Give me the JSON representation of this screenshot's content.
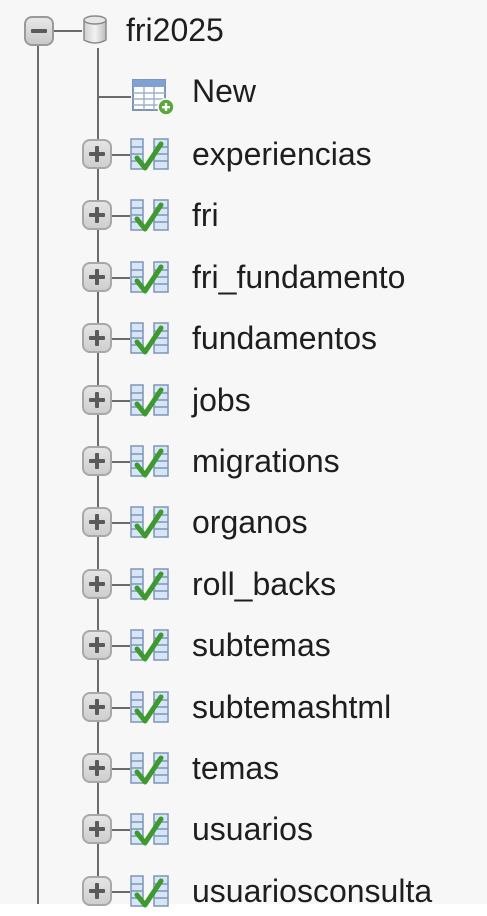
{
  "database": {
    "name": "fri2025",
    "icon": "database-icon",
    "expanded": true
  },
  "new_item": {
    "label": "New",
    "icon": "new-table-icon"
  },
  "tables": [
    {
      "label": "experiencias",
      "icon": "table-icon"
    },
    {
      "label": "fri",
      "icon": "table-icon"
    },
    {
      "label": "fri_fundamento",
      "icon": "table-icon"
    },
    {
      "label": "fundamentos",
      "icon": "table-icon"
    },
    {
      "label": "jobs",
      "icon": "table-icon"
    },
    {
      "label": "migrations",
      "icon": "table-icon"
    },
    {
      "label": "organos",
      "icon": "table-icon"
    },
    {
      "label": "roll_backs",
      "icon": "table-icon"
    },
    {
      "label": "subtemas",
      "icon": "table-icon"
    },
    {
      "label": "subtemashtml",
      "icon": "table-icon"
    },
    {
      "label": "temas",
      "icon": "table-icon"
    },
    {
      "label": "usuarios",
      "icon": "table-icon"
    },
    {
      "label": "usuariosconsulta",
      "icon": "table-icon"
    }
  ]
}
